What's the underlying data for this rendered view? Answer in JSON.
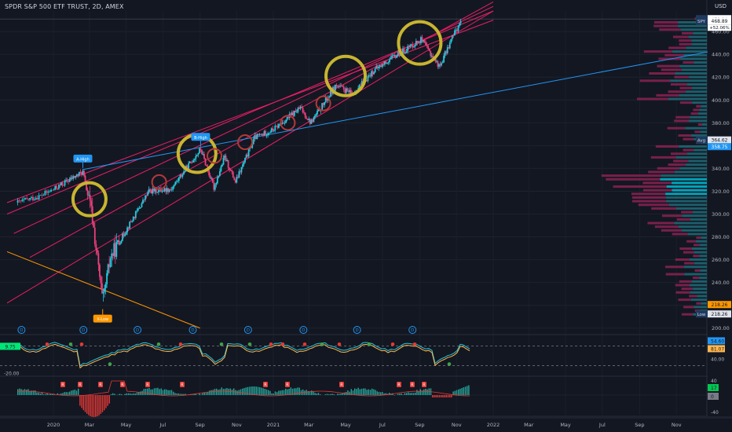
{
  "header": {
    "symbol_title": "SPDR S&P 500 ETF TRUST, 2D, AMEX",
    "currency": "USD"
  },
  "chart_data": {
    "type": "candlestick",
    "title": "SPDR S&P 500 ETF TRUST, 2D, AMEX",
    "xlabel": "",
    "ylabel": "",
    "ylim": [
      195,
      478
    ],
    "x_tick_labels": [
      "2020",
      "Mar",
      "May",
      "Jul",
      "Sep",
      "Nov",
      "2021",
      "Mar",
      "May",
      "Jul",
      "Sep",
      "Nov",
      "2022",
      "Mar",
      "May",
      "Jul",
      "Sep",
      "Nov"
    ],
    "y_tick_values": [
      200,
      220,
      240,
      260,
      280,
      300,
      320,
      340,
      360,
      380,
      400,
      420,
      440,
      460
    ],
    "price_path": [
      {
        "date": "2019-11-15",
        "value": 310
      },
      {
        "date": "2019-12-15",
        "value": 316
      },
      {
        "date": "2020-01-15",
        "value": 326
      },
      {
        "date": "2020-02-19",
        "value": 337
      },
      {
        "date": "2020-03-05",
        "value": 300
      },
      {
        "date": "2020-03-23",
        "value": 222
      },
      {
        "date": "2020-04-05",
        "value": 262
      },
      {
        "date": "2020-05-01",
        "value": 286
      },
      {
        "date": "2020-06-08",
        "value": 320
      },
      {
        "date": "2020-07-15",
        "value": 322
      },
      {
        "date": "2020-09-02",
        "value": 357
      },
      {
        "date": "2020-09-24",
        "value": 323
      },
      {
        "date": "2020-10-12",
        "value": 350
      },
      {
        "date": "2020-10-30",
        "value": 328
      },
      {
        "date": "2020-12-01",
        "value": 367
      },
      {
        "date": "2021-01-01",
        "value": 374
      },
      {
        "date": "2021-02-15",
        "value": 393
      },
      {
        "date": "2021-03-04",
        "value": 380
      },
      {
        "date": "2021-04-15",
        "value": 413
      },
      {
        "date": "2021-05-12",
        "value": 405
      },
      {
        "date": "2021-06-15",
        "value": 425
      },
      {
        "date": "2021-07-15",
        "value": 436
      },
      {
        "date": "2021-09-03",
        "value": 453
      },
      {
        "date": "2021-10-04",
        "value": 429
      },
      {
        "date": "2021-10-25",
        "value": 455
      },
      {
        "date": "2021-11-08",
        "value": 468.89
      }
    ],
    "annotations": [
      {
        "label": "A-High",
        "date": "2020-02-19",
        "value": 339
      },
      {
        "label": "B-High",
        "date": "2020-09-02",
        "value": 358
      },
      {
        "label": "X-Low",
        "date": "2020-03-23",
        "value": 218
      }
    ],
    "price_labels": [
      {
        "text": "High",
        "value": "470.94"
      },
      {
        "text": "SPY",
        "value": "468.89",
        "change": "+52.06%"
      },
      {
        "text": "Avg",
        "value": "364.62"
      },
      {
        "text": "",
        "value": "358.75"
      },
      {
        "text": "",
        "value": "218.26"
      },
      {
        "text": "Low",
        "value": "218.26"
      }
    ],
    "oscillator": {
      "left_label": "-20.00",
      "left_badge": "9.75",
      "right_labels": [
        "54.60",
        "81.07",
        "40.00"
      ],
      "dashed_levels": [
        80,
        20
      ]
    },
    "momentum": {
      "right_labels": [
        "40",
        "17",
        "0",
        "-40"
      ],
      "marker_label": "R"
    },
    "event_markers": {
      "label": "D",
      "dates": [
        "2019-11-20",
        "2020-02-20",
        "2020-05-20",
        "2020-08-20",
        "2020-11-20",
        "2021-02-20",
        "2021-05-20",
        "2021-08-20"
      ]
    },
    "colors": {
      "background": "#131722",
      "up": "#26c6da",
      "down": "#ec407a",
      "channel": "#e91e63",
      "trend_blue": "#2196f3",
      "trend_orange": "#ff9800",
      "circle_gold": "#c8b530",
      "circle_red": "#b33939"
    }
  }
}
